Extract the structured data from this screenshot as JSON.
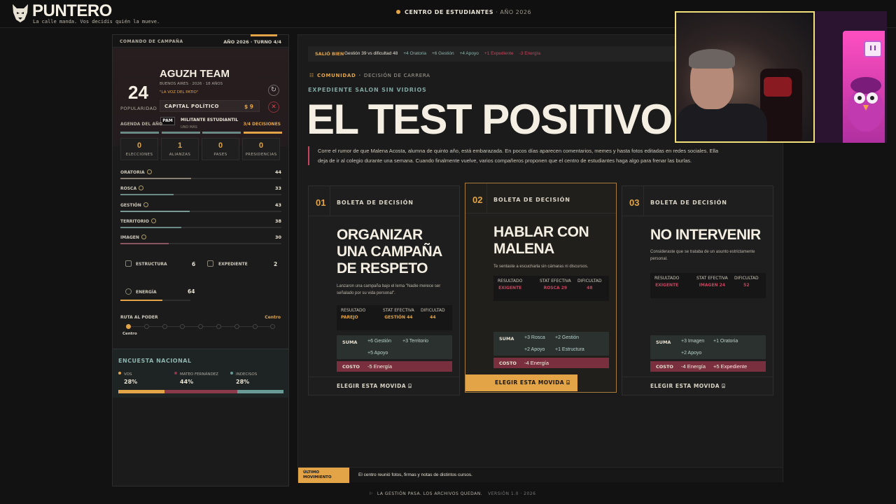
{
  "brand": {
    "name": "PUNTERO",
    "tagline": "La calle manda. Vos decidís quién la mueve."
  },
  "header": {
    "title": "CENTRO DE ESTUDIANTES",
    "year": "· AÑO 2026"
  },
  "campaign": {
    "header_label": "COMANDO DE CAMPAÑA",
    "header_right": "AÑO 2026 · TURNO 4/4",
    "popularity": "24",
    "popularity_label": "POPULARIDAD",
    "team_name": "AGUZH TEAM",
    "team_meta": "BUENOS AIRES   ·   2026   ·   18 AÑOS",
    "team_quote": "\"LA VOZ DEL PATIO\"",
    "capital_label": "CAPITAL POLÍTICO",
    "capital_value": "$ 9",
    "faction_tag": "PAM",
    "faction_name": "MILITANTE ESTUDIANTIL",
    "faction_sub": "UNO MÁS",
    "agenda_label": "AGENDA DEL AÑO",
    "agenda_value": "3/4 DECISIONES",
    "agenda_done": 3,
    "agenda_total": 4,
    "counters": [
      {
        "value": "0",
        "label": "ELECCIONES"
      },
      {
        "value": "1",
        "label": "ALIANZAS"
      },
      {
        "value": "0",
        "label": "PASES"
      },
      {
        "value": "0",
        "label": "PRESIDENCIAS"
      }
    ],
    "skills": [
      {
        "name": "ORATORIA",
        "value": "44",
        "level": 44,
        "color": "#8a7f74"
      },
      {
        "name": "ROSCA",
        "value": "33",
        "level": 33,
        "color": "#6a8a85"
      },
      {
        "name": "GESTIÓN",
        "value": "43",
        "level": 43,
        "color": "#7a9a95"
      },
      {
        "name": "TERRITORIO",
        "value": "38",
        "level": 38,
        "color": "#6a8a85"
      },
      {
        "name": "IMAGEN",
        "value": "30",
        "level": 30,
        "color": "#8a5560"
      }
    ],
    "estructura_label": "ESTRUCTURA",
    "estructura_value": "6",
    "expediente_label": "EXPEDIENTE",
    "expediente_value": "2",
    "energia_label": "ENERGÍA",
    "energia_value": "64",
    "ruta_label": "RUTA AL PODER",
    "ruta_value": "Centro",
    "ruta_current": "Centro"
  },
  "poll": {
    "title": "ENCUESTA NACIONAL",
    "items": [
      {
        "name": "VOS",
        "pct": "28%",
        "share": 28,
        "color": "#e2a447"
      },
      {
        "name": "MATEO FERNÁNDEZ",
        "pct": "44%",
        "share": 44,
        "color": "#8a3a4a"
      },
      {
        "name": "INDECISOS",
        "pct": "28%",
        "share": 28,
        "color": "#6a9a95"
      }
    ]
  },
  "result": {
    "label": "SALIÓ BIEN",
    "detail": "Gestión 39 vs dificultad 48",
    "effects_pos": [
      "+4 Oratoria",
      "+6 Gestión",
      "+4 Apoyo"
    ],
    "effects_neg": [
      "+1 Expediente",
      "-3 Energía"
    ]
  },
  "event": {
    "category": "COMUNIDAD",
    "type": "DECISIÓN DE CARRERA",
    "expediente": "EXPEDIENTE SALON SIN VIDRIOS",
    "title": "EL TEST POSITIVO",
    "story": "Corre el rumor de que Malena Acosta, alumna de quinto año, está embarazada. En pocos días aparecen comentarios, memes y hasta fotos editadas en redes sociales. Ella deja de ir al colegio durante una semana. Cuando finalmente vuelve, varios compañeros proponen que el centro de estudiantes haga algo para frenar las burlas."
  },
  "labels": {
    "boleta": "BOLETA DE DECISIÓN",
    "resultado": "RESULTADO",
    "stat": "STAT EFECTIVA",
    "dificultad": "DIFICULTAD",
    "suma": "SUMA",
    "costo": "COSTO",
    "choose": "ELEGIR ESTA MOVIDA"
  },
  "options": [
    {
      "num": "01",
      "title": "ORGANIZAR UNA CAMPAÑA DE RESPETO",
      "desc": "Lanzaron una campaña bajo el lema \"Nadie merece ser señalado por su vida personal\".",
      "resultado": "PAREJO",
      "stat": "GESTIÓN 44",
      "dificultad": "44",
      "value_color": "#e2a447",
      "suma": [
        "+6 Gestión",
        "+3 Territorio",
        "+5 Apoyo"
      ],
      "costo": [
        "-5 Energía"
      ]
    },
    {
      "num": "02",
      "title": "HABLAR CON MALENA",
      "desc": "Te sentaste a escucharla sin cámaras ni discursos.",
      "resultado": "EXIGENTE",
      "stat": "ROSCA 29",
      "dificultad": "48",
      "value_color": "#c8435c",
      "suma": [
        "+3 Rosca",
        "+2 Gestión",
        "+2 Apoyo",
        "+1 Estructura"
      ],
      "costo": [
        "-4 Energía"
      ]
    },
    {
      "num": "03",
      "title": "NO INTERVENIR",
      "desc": "Consideraste que se trataba de un asunto estrictamente personal.",
      "resultado": "EXIGENTE",
      "stat": "IMAGEN 24",
      "dificultad": "52",
      "value_color": "#c8435c",
      "suma": [
        "+3 Imagen",
        "+1 Oratoria",
        "+2 Apoyo"
      ],
      "costo": [
        "-4 Energía",
        "+5 Expediente"
      ]
    }
  ],
  "last_move": {
    "label_line1": "ÚLTIMO",
    "label_line2": "MOVIMIENTO",
    "text": "El centro reunió fotos, firmas y notas de distintos cursos."
  },
  "footer": {
    "text": "LA GESTIÓN PASA. LOS ARCHIVOS QUEDAN.",
    "version": "VERSIÓN 1.0 · 2026"
  },
  "colors": {
    "accent": "#e2a447",
    "positive": "#8fb3ad",
    "negative": "#c8435c",
    "webcam_border": "#f2e07a"
  }
}
